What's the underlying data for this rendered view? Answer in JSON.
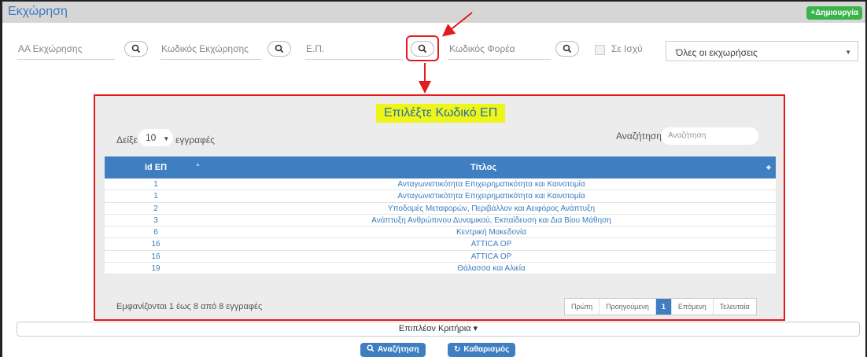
{
  "header": {
    "title": "Εκχώρηση",
    "create_label": "+Δημιουργία"
  },
  "filters": {
    "aa_label": "ΑΑ Εκχώρησης",
    "code_label": "Κωδικός Εκχώρησης",
    "ep_label": "Ε.Π.",
    "agency_label": "Κωδικός Φορέα",
    "in_force_label": "Σε Ισχύ",
    "status_value": "Όλες οι εκχωρήσεις"
  },
  "modal": {
    "title": "Επιλέξτε Κωδικό ΕΠ",
    "show_label": "Δείξε",
    "page_length": "10",
    "records_label": "εγγραφές",
    "search_label": "Αναζήτηση:",
    "search_placeholder": "Αναζήτηση",
    "columns": [
      "Id ΕΠ",
      "Τίτλος"
    ],
    "rows": [
      {
        "id": "1",
        "title": "Ανταγωνιστικότητα Επιχειρηματικότητα και Καινοτομία"
      },
      {
        "id": "1",
        "title": "Ανταγωνιστικότητα Επιχειρηματικότητα και Καινοτομία"
      },
      {
        "id": "2",
        "title": "Υποδομές Μεταφορών, Περιβάλλον και Αειφόρος Ανάπτυξη"
      },
      {
        "id": "3",
        "title": "Ανάπτυξη Ανθρώπινου Δυναμικού, Εκπαίδευση και Δια Βίου Μάθηση"
      },
      {
        "id": "6",
        "title": "Κεντρική Μακεδονία"
      },
      {
        "id": "16",
        "title": "ATTICA OP"
      },
      {
        "id": "16",
        "title": "ATTICA OP"
      },
      {
        "id": "19",
        "title": "Θάλασσα και Αλιεία"
      }
    ],
    "info": "Εμφανίζονται 1 έως 8 από 8 εγγραφές",
    "pager": {
      "first": "Πρώτη",
      "prev": "Προηγούμενη",
      "current": "1",
      "next": "Επόμενη",
      "last": "Τελευταία"
    }
  },
  "footer": {
    "more_criteria": "Επιπλέον Κριτήρια ▾",
    "search_button": "Αναζήτηση",
    "clear_button": "Καθαρισμός"
  },
  "colors": {
    "annotation": "#e21b1b",
    "accent": "#3f7fc1",
    "create": "#3bb34a",
    "highlight": "#eef51b"
  }
}
